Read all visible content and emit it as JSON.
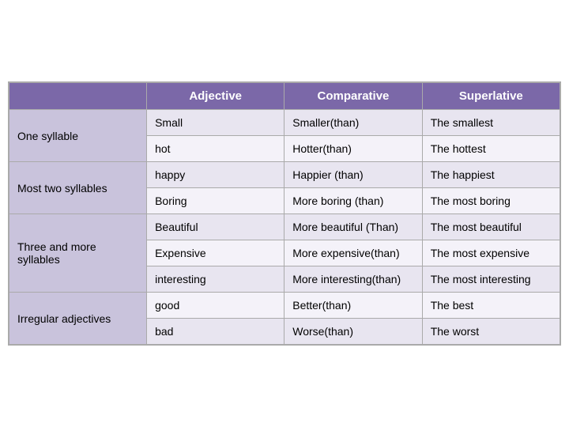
{
  "headers": {
    "col0": "",
    "col1": "Adjective",
    "col2": "Comparative",
    "col3": "Superlative"
  },
  "rows": [
    {
      "category": "One syllable",
      "categoryRowspan": 2,
      "adjective": "Small",
      "comparative": "Smaller(than)",
      "superlative": "The smallest",
      "rowType": "odd"
    },
    {
      "category": null,
      "adjective": "hot",
      "comparative": "Hotter(than)",
      "superlative": "The hottest",
      "rowType": "even"
    },
    {
      "category": "Most  two syllables",
      "categoryRowspan": 2,
      "adjective": "happy",
      "comparative": "Happier (than)",
      "superlative": "The happiest",
      "rowType": "odd"
    },
    {
      "category": null,
      "adjective": "Boring",
      "comparative": "More boring (than)",
      "superlative": "The most boring",
      "rowType": "even"
    },
    {
      "category": "Three and more syllables",
      "categoryRowspan": 3,
      "adjective": "Beautiful",
      "comparative": "More beautiful (Than)",
      "superlative": "The most beautiful",
      "rowType": "odd"
    },
    {
      "category": null,
      "adjective": "Expensive",
      "comparative": "More expensive(than)",
      "superlative": "The most expensive",
      "rowType": "even"
    },
    {
      "category": null,
      "adjective": "interesting",
      "comparative": "More interesting(than)",
      "superlative": "The most interesting",
      "rowType": "odd"
    },
    {
      "category": "Irregular adjectives",
      "categoryRowspan": 2,
      "adjective": "good",
      "comparative": "Better(than)",
      "superlative": "The best",
      "rowType": "even"
    },
    {
      "category": null,
      "adjective": "bad",
      "comparative": "Worse(than)",
      "superlative": "The worst",
      "rowType": "odd"
    }
  ]
}
